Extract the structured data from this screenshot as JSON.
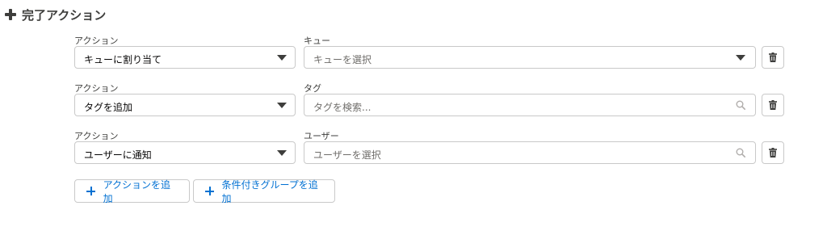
{
  "section": {
    "title": "完了アクション",
    "icon": "plus-icon"
  },
  "rows": [
    {
      "action_label": "アクション",
      "action_value": "キューに割り当て",
      "target_label": "キュー",
      "target_placeholder": "キューを選択",
      "target_kind": "dropdown"
    },
    {
      "action_label": "アクション",
      "action_value": "タグを追加",
      "target_label": "タグ",
      "target_placeholder": "タグを検索...",
      "target_kind": "search"
    },
    {
      "action_label": "アクション",
      "action_value": "ユーザーに通知",
      "target_label": "ユーザー",
      "target_placeholder": "ユーザーを選択",
      "target_kind": "search"
    }
  ],
  "buttons": {
    "add_action": "アクションを追加",
    "add_conditional_group": "条件付きグループを追加"
  },
  "colors": {
    "link": "#0070d2",
    "border": "#c9c9c9",
    "text": "#3e3e3c",
    "placeholder": "#706e6b"
  }
}
